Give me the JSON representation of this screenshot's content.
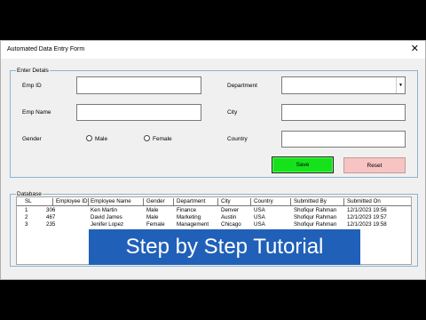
{
  "window": {
    "title": "Automated Data Entry Form",
    "close_glyph": "✕"
  },
  "details": {
    "group_label": "Enter Detals",
    "emp_id_label": "Emp ID",
    "emp_name_label": "Emp Name",
    "gender_label": "Gender",
    "male_label": "Male",
    "female_label": "Female",
    "department_label": "Department",
    "city_label": "City",
    "country_label": "Country",
    "emp_id_value": "",
    "emp_name_value": "",
    "department_value": "",
    "city_value": "",
    "country_value": "",
    "dropdown_icon": "chevron-down-icon"
  },
  "buttons": {
    "save": "Save",
    "reset": "Reset"
  },
  "database": {
    "group_label": "Database",
    "columns": [
      "SL",
      "Employee ID",
      "Employee Name",
      "Gender",
      "Department",
      "City",
      "Country",
      "Submitted By",
      "Submitted On"
    ],
    "rows": [
      [
        "1",
        "306",
        "Ken Martin",
        "Male",
        "Finance",
        "Denver",
        "USA",
        "Shofiqur Rahman",
        "12/1/2023 19:56"
      ],
      [
        "2",
        "467",
        "David James",
        "Male",
        "Marketing",
        "Austin",
        "USA",
        "Shofiqur Rahman",
        "12/1/2023 19:57"
      ],
      [
        "3",
        "235",
        "Jenifer Lopez",
        "Female",
        "Management",
        "Chicago",
        "USA",
        "Shofiqur Rahman",
        "12/1/2023 19:58"
      ]
    ]
  },
  "banner": {
    "text": "Step by Step Tutorial"
  },
  "colors": {
    "save": "#16e21c",
    "reset": "#f7c3c3",
    "banner": "#2060b8",
    "group_border": "#8fb3d0"
  }
}
